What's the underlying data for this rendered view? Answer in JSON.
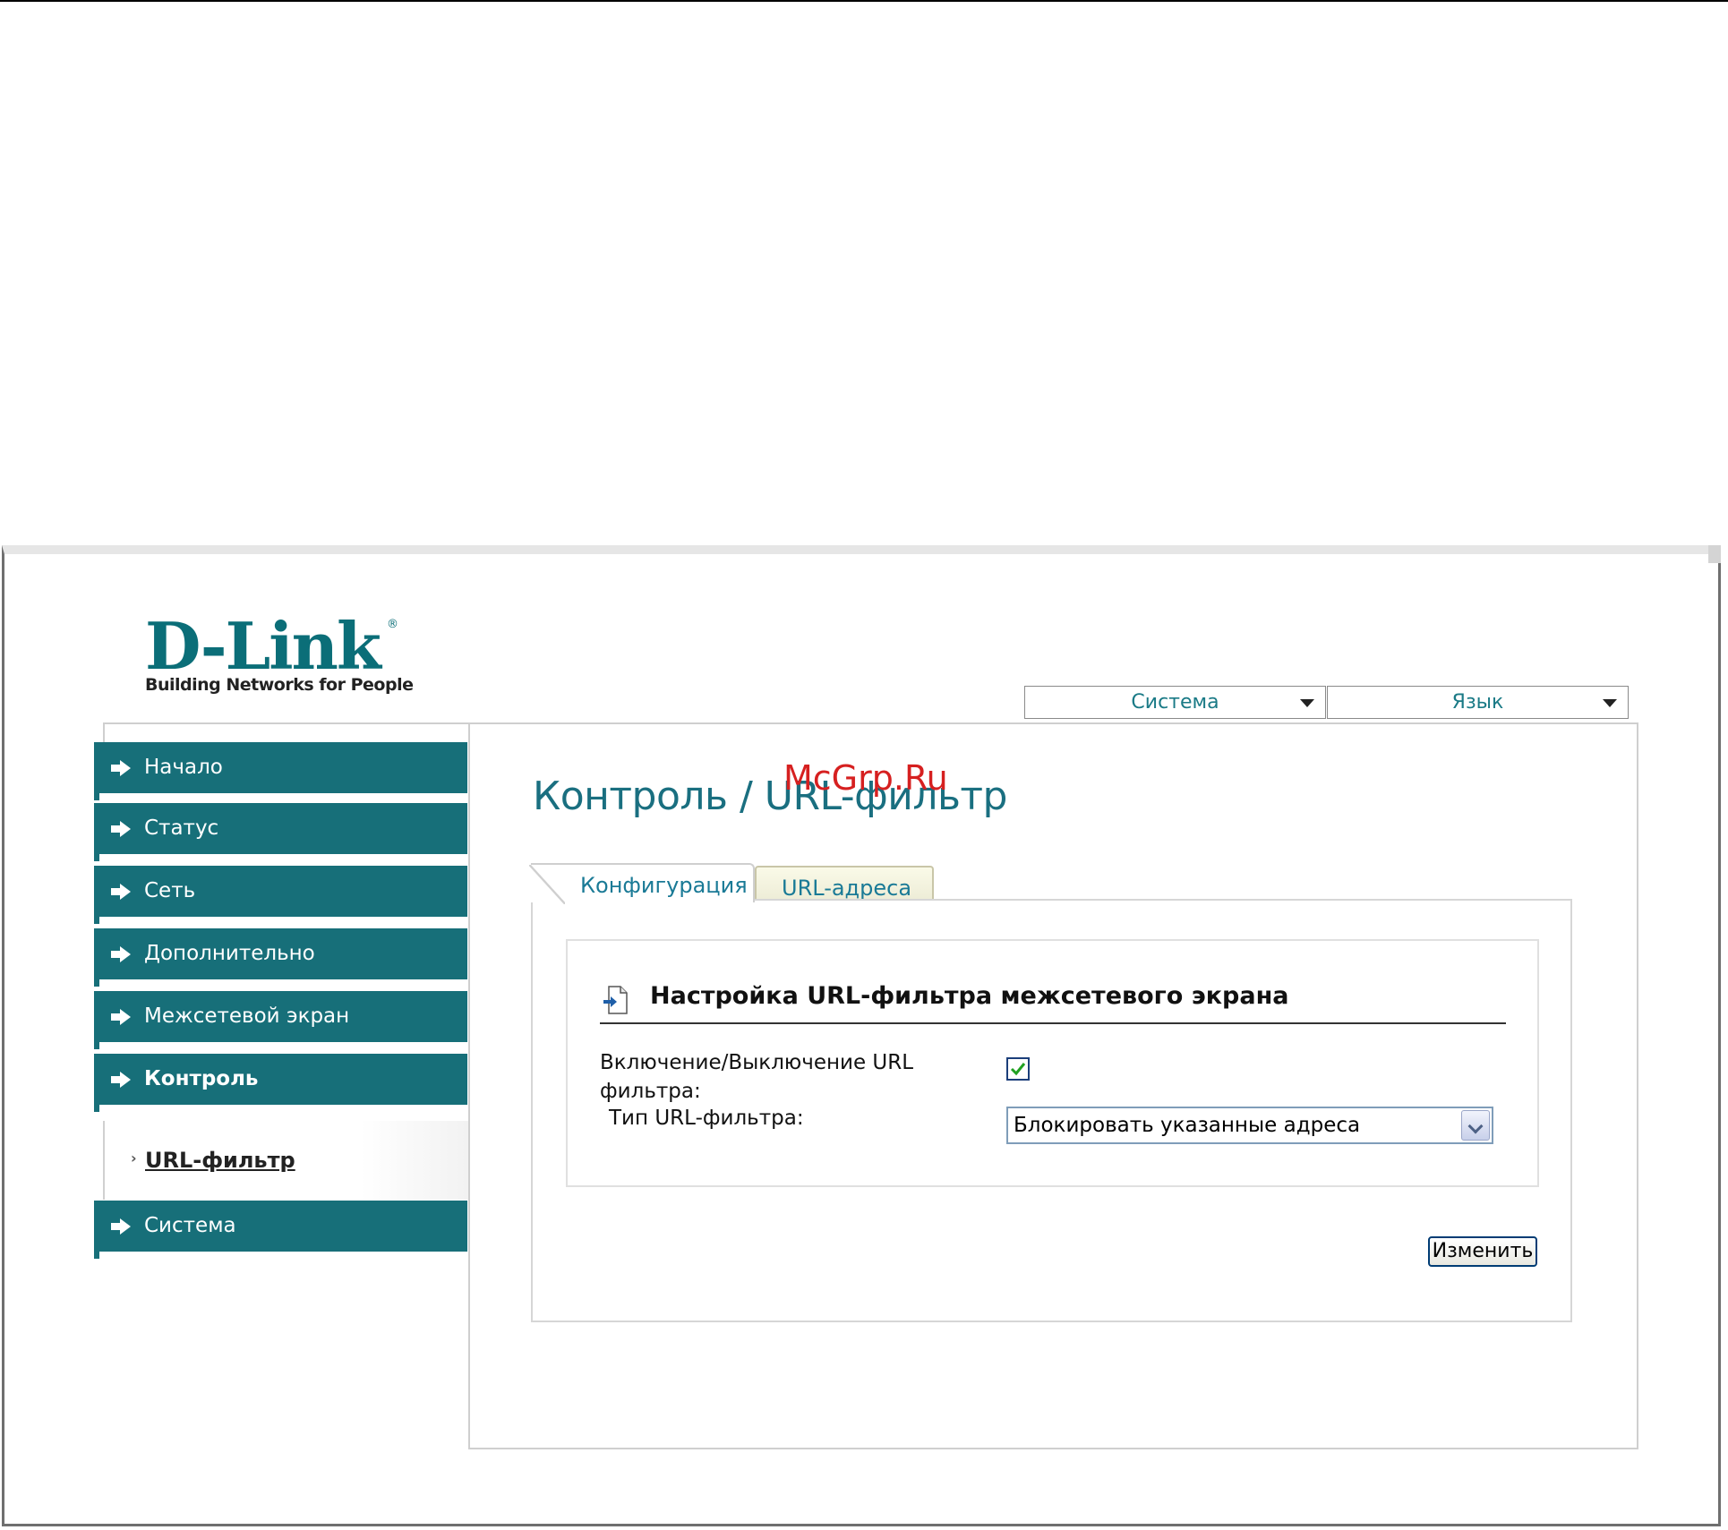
{
  "logo": {
    "word": "D-Link",
    "tagline": "Building Networks for People",
    "reg": "®"
  },
  "top_menus": {
    "system": "Система",
    "language": "Язык"
  },
  "sidebar": {
    "items": [
      {
        "label": "Начало"
      },
      {
        "label": "Статус"
      },
      {
        "label": "Сеть"
      },
      {
        "label": "Дополнительно"
      },
      {
        "label": "Межсетевой экран"
      },
      {
        "label": "Контроль"
      },
      {
        "label": "Система"
      }
    ],
    "subitem": "URL-фильтр"
  },
  "page": {
    "title": "Контроль / URL-фильтр",
    "watermark": "McGrp.Ru"
  },
  "tabs": {
    "config": "Конфигурация",
    "urls": "URL-адреса"
  },
  "section": {
    "title": "Настройка URL-фильтра межсетевого экрана",
    "enable_label": "Включение/Выключение URL фильтра:",
    "enable_checked": true,
    "type_label": "Тип URL-фильтра:",
    "type_value": "Блокировать указанные адреса"
  },
  "buttons": {
    "apply": "Изменить"
  },
  "colors": {
    "brand": "#176f79",
    "title": "#1a6f80",
    "link": "#1a7a96",
    "watermark": "#d62020"
  }
}
